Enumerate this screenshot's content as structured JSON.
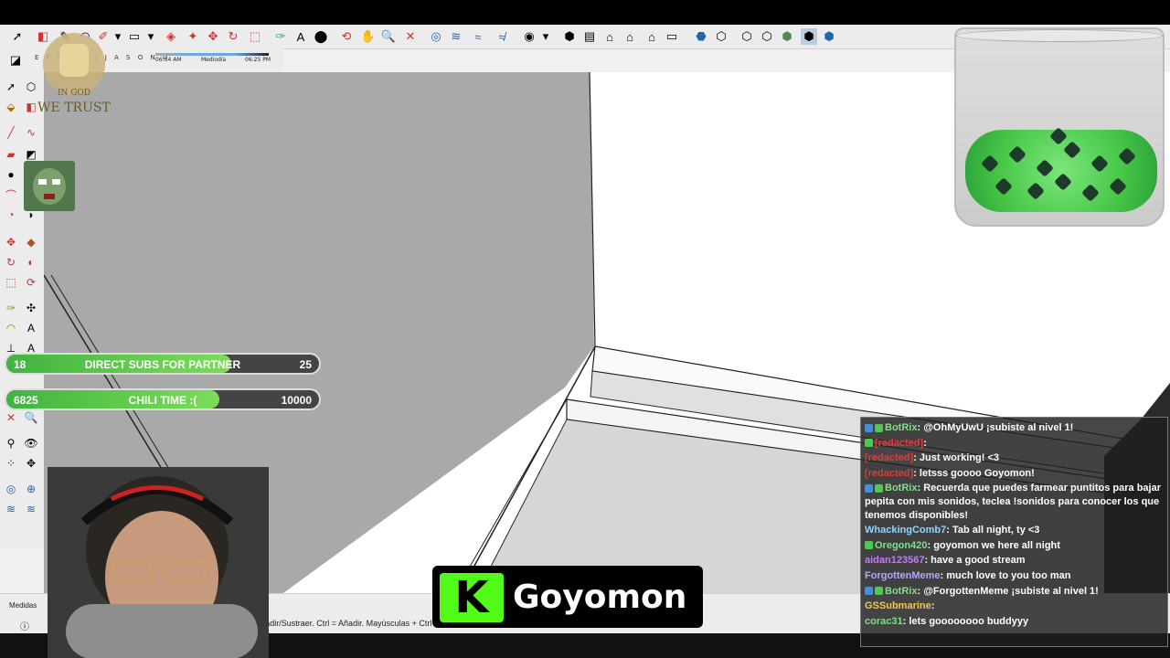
{
  "app": {
    "toolbar2": {
      "shadow_months": "E F M A M J J A S O N D",
      "time_start": "06:54 AM",
      "time_mid": "Mediodía",
      "time_end": "06:25 PM"
    },
    "status": {
      "label": "Medidas",
      "hint": "= Añadir/Sustraer. Ctrl = Añadir. Mayúsculas + Ctrl ="
    }
  },
  "overlay": {
    "logo_text": "IN GOD WE TRUST",
    "goals": [
      {
        "left_value": "18",
        "title": "DIRECT SUBS FOR PARTNER",
        "right_value": "25",
        "progress": 0.72
      },
      {
        "left_value": "6825",
        "title": "CHILI TIME :(",
        "right_value": "10000",
        "progress": 0.6825
      }
    ],
    "kick": {
      "logo_letter": "K",
      "channel": "Goyomon",
      "brand_color": "#53fc18"
    }
  },
  "chat": {
    "messages": [
      {
        "user": "BotRix",
        "user_color": "#7ee08a",
        "badges": [
          "bot",
          "mod"
        ],
        "text": "@OhMyUwU ¡subiste al nivel 1!"
      },
      {
        "user": "[redacted]",
        "user_color": "#e03b3b",
        "badges": [
          "mod"
        ],
        "text": ""
      },
      {
        "user": "[redacted]",
        "user_color": "#e03b3b",
        "badges": [],
        "text": "Just working! <3"
      },
      {
        "user": "[redacted]",
        "user_color": "#e03b3b",
        "badges": [],
        "text": "letsss goooo Goyomon!"
      },
      {
        "user": "BotRix",
        "user_color": "#7ee08a",
        "badges": [
          "bot",
          "mod"
        ],
        "text": "Recuerda que puedes farmear puntitos para bajar pepita con mis sonidos, teclea !sonidos para conocer los que tenemos disponibles!"
      },
      {
        "user": "WhackingComb7",
        "user_color": "#8fd4ff",
        "badges": [],
        "text": "Tab all night, ty <3"
      },
      {
        "user": "Oregon420",
        "user_color": "#7ee08a",
        "badges": [
          "mod"
        ],
        "text": "goyomon we here all night"
      },
      {
        "user": "aidan123567",
        "user_color": "#c678ff",
        "badges": [],
        "text": "have a good stream"
      },
      {
        "user": "ForgottenMeme",
        "user_color": "#b6a6ff",
        "badges": [],
        "text": "much love to you too man"
      },
      {
        "user": "BotRix",
        "user_color": "#7ee08a",
        "badges": [
          "bot",
          "mod"
        ],
        "text": "@ForgottenMeme ¡subiste al nivel 1!"
      },
      {
        "user": "GSSubmarine",
        "user_color": "#f2c94c",
        "badges": [],
        "text": ""
      },
      {
        "user": "corac31",
        "user_color": "#7ee08a",
        "badges": [],
        "text": "lets goooooooo buddyyy"
      }
    ]
  }
}
